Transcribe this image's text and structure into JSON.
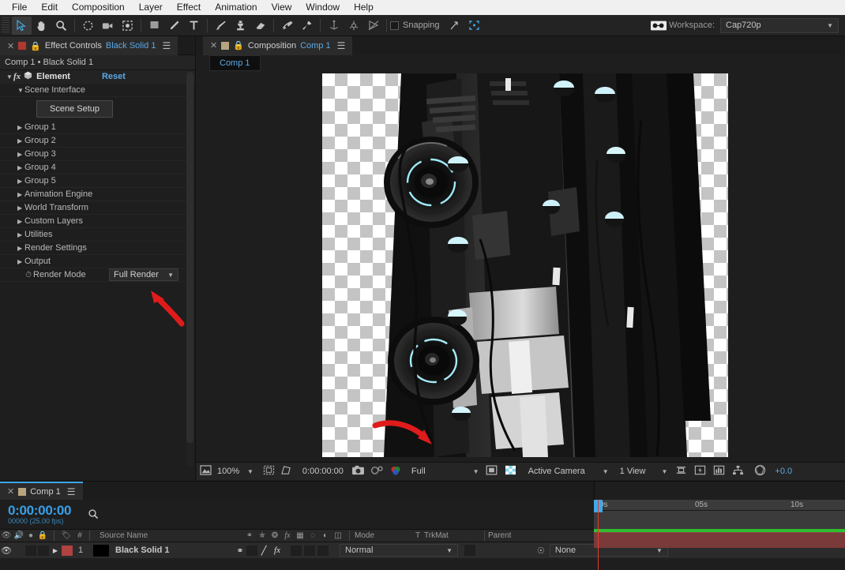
{
  "menubar": {
    "items": [
      "File",
      "Edit",
      "Composition",
      "Layer",
      "Effect",
      "Animation",
      "View",
      "Window",
      "Help"
    ]
  },
  "toolbar": {
    "tools": [
      {
        "name": "selection-tool",
        "active": true
      },
      {
        "name": "hand-tool",
        "active": false
      },
      {
        "name": "zoom-tool",
        "active": false
      },
      {
        "name": "rotation-tool",
        "active": false
      },
      {
        "name": "camera-tool",
        "active": false
      },
      {
        "name": "pan-behind-tool",
        "active": false
      },
      {
        "name": "shape-tool",
        "active": false
      },
      {
        "name": "pen-tool",
        "active": false
      },
      {
        "name": "type-tool",
        "active": false
      },
      {
        "name": "brush-tool",
        "active": false
      },
      {
        "name": "clone-stamp-tool",
        "active": false
      },
      {
        "name": "eraser-tool",
        "active": false
      },
      {
        "name": "roto-brush-tool",
        "active": false
      },
      {
        "name": "puppet-pin-tool",
        "active": false
      }
    ],
    "axis_icons": [
      "local-axis-icon",
      "world-axis-icon",
      "view-axis-icon"
    ],
    "snapping_label": "Snapping",
    "snapping_checked": false,
    "workspace_label": "Workspace:",
    "workspace_value": "Cap720p"
  },
  "effect_controls": {
    "tab_title": "Effect Controls",
    "tab_subject": "Black Solid 1",
    "breadcrumb": "Comp 1 • Black Solid 1",
    "effect_name": "Element",
    "reset_label": "Reset",
    "section_label": "Scene Interface",
    "scene_setup_label": "Scene Setup",
    "groups": [
      "Group 1",
      "Group 2",
      "Group 3",
      "Group 4",
      "Group 5",
      "Animation Engine",
      "World Transform",
      "Custom Layers",
      "Utilities",
      "Render Settings",
      "Output"
    ],
    "render_mode_label": "Render Mode",
    "render_mode_value": "Full Render"
  },
  "composition": {
    "tab_title": "Composition",
    "tab_name": "Comp 1",
    "inner_tab": "Comp 1",
    "bottom_bar": {
      "magnification": "100%",
      "time": "0:00:00:00",
      "resolution": "Full",
      "camera": "Active Camera",
      "views": "1 View",
      "exposure": "+0.0"
    }
  },
  "timeline": {
    "tab_name": "Comp 1",
    "current_time": "0:00:00:00",
    "frame_info": "00000 (25.00 fps)",
    "columns": {
      "source_name": "Source Name",
      "mode": "Mode",
      "t": "T",
      "trkmat": "TrkMat",
      "parent": "Parent",
      "index": "#"
    },
    "layers": [
      {
        "index": "1",
        "source_name": "Black Solid 1",
        "mode": "Normal",
        "parent": "None",
        "label_color": "#b04242"
      }
    ],
    "ruler_ticks": [
      "0s",
      "05s",
      "10s"
    ],
    "toolbar_icons": [
      "graph-editor-icon",
      "motion-blur-icon",
      "brainstorm-icon",
      "frame-blending-icon",
      "motion-sketch-icon",
      "smoother-icon",
      "wiggler-icon"
    ]
  },
  "annotations": {
    "arrow_render_mode": "arrow pointing at Render Mode dropdown",
    "arrow_viewer": "arrow pointing into viewer",
    "color": "#e01b1b"
  },
  "colors": {
    "accent_blue": "#5aa9e6",
    "panel_bg": "#1e1e1e",
    "work_area_green": "#2fbe2f",
    "layer_bar": "#7a3a3a",
    "playhead_red": "#e23a2e"
  }
}
